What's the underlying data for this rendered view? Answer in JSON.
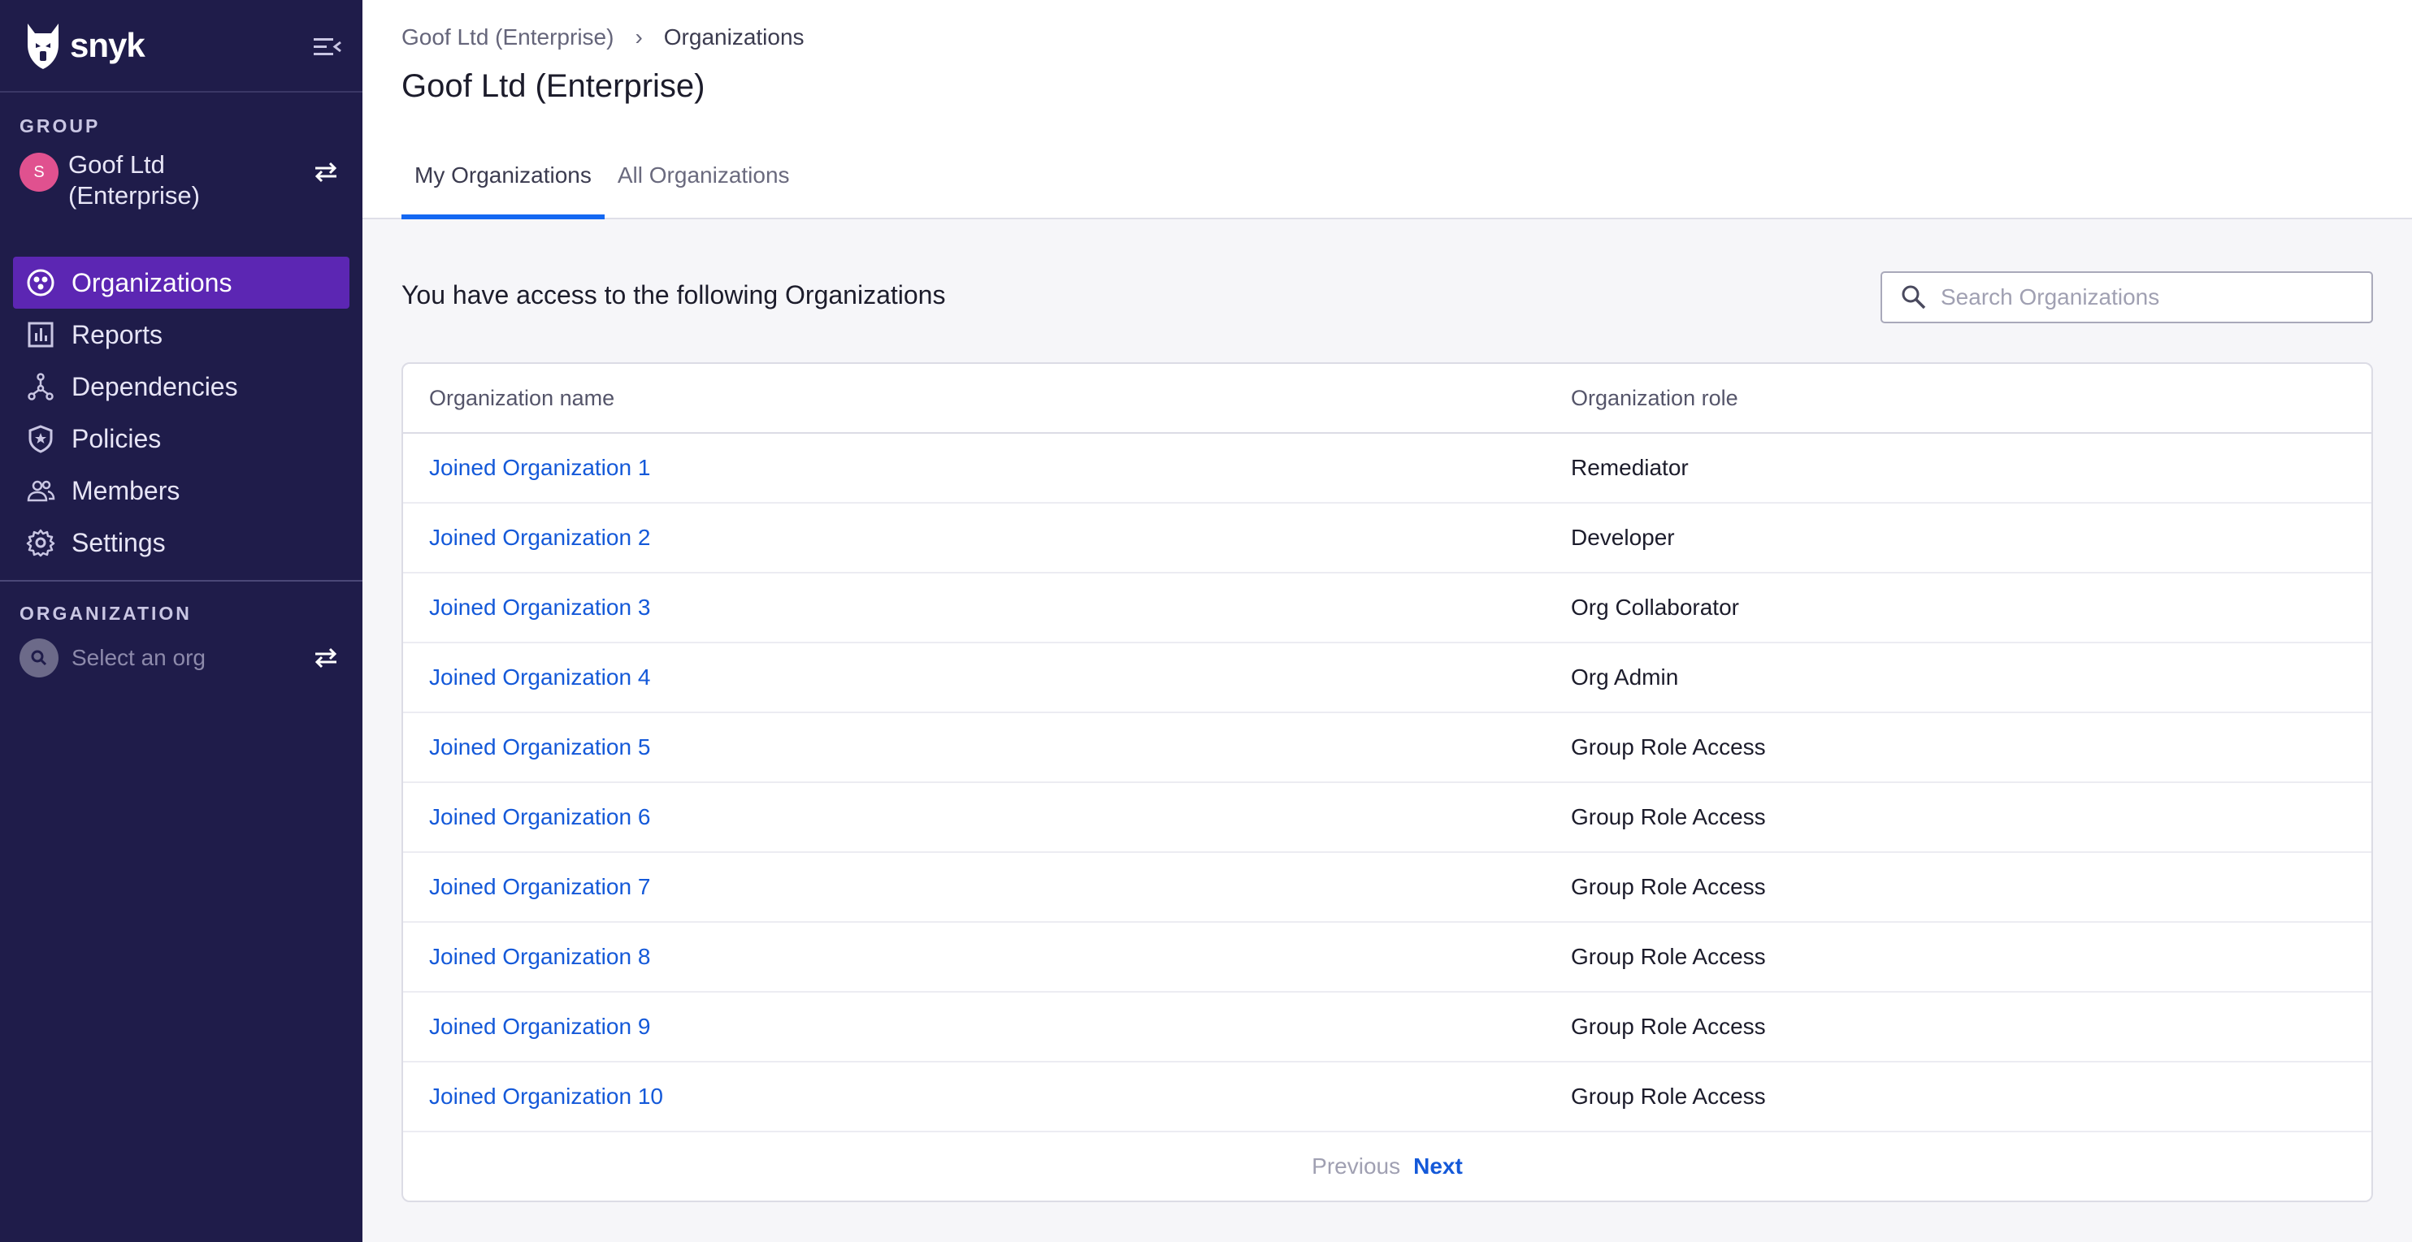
{
  "brand": {
    "name": "snyk"
  },
  "sidebar": {
    "group_section_label": "GROUP",
    "group": {
      "avatar_initial": "S",
      "name": "Goof Ltd (Enterprise)"
    },
    "nav": [
      {
        "label": "Organizations",
        "icon": "organizations-icon",
        "active": true
      },
      {
        "label": "Reports",
        "icon": "reports-icon",
        "active": false
      },
      {
        "label": "Dependencies",
        "icon": "dependencies-icon",
        "active": false
      },
      {
        "label": "Policies",
        "icon": "policies-icon",
        "active": false
      },
      {
        "label": "Members",
        "icon": "members-icon",
        "active": false
      },
      {
        "label": "Settings",
        "icon": "gear-icon",
        "active": false
      }
    ],
    "org_section_label": "ORGANIZATION",
    "org_selector_placeholder": "Select an org"
  },
  "header": {
    "breadcrumb": {
      "parent": "Goof Ltd (Enterprise)",
      "current": "Organizations"
    },
    "title": "Goof Ltd (Enterprise)",
    "tabs": [
      {
        "label": "My Organizations",
        "active": true
      },
      {
        "label": "All Organizations",
        "active": false
      }
    ]
  },
  "main": {
    "heading": "You have access to the following Organizations",
    "search_placeholder": "Search Organizations",
    "table": {
      "columns": [
        "Organization name",
        "Organization role"
      ],
      "rows": [
        {
          "name": "Joined Organization 1",
          "role": "Remediator"
        },
        {
          "name": "Joined Organization 2",
          "role": "Developer"
        },
        {
          "name": "Joined Organization 3",
          "role": "Org Collaborator"
        },
        {
          "name": "Joined Organization 4",
          "role": "Org Admin"
        },
        {
          "name": "Joined Organization 5",
          "role": "Group Role Access"
        },
        {
          "name": "Joined Organization 6",
          "role": "Group Role Access"
        },
        {
          "name": "Joined Organization 7",
          "role": "Group Role Access"
        },
        {
          "name": "Joined Organization 8",
          "role": "Group Role Access"
        },
        {
          "name": "Joined Organization 9",
          "role": "Group Role Access"
        },
        {
          "name": "Joined Organization 10",
          "role": "Group Role Access"
        }
      ]
    },
    "pagination": {
      "previous": "Previous",
      "next": "Next"
    }
  },
  "colors": {
    "sidebar_bg": "#1f1c4a",
    "nav_active_bg": "#5c26b3",
    "link": "#1459d9",
    "tab_indicator": "#1468f2",
    "avatar": "#e0518f"
  }
}
